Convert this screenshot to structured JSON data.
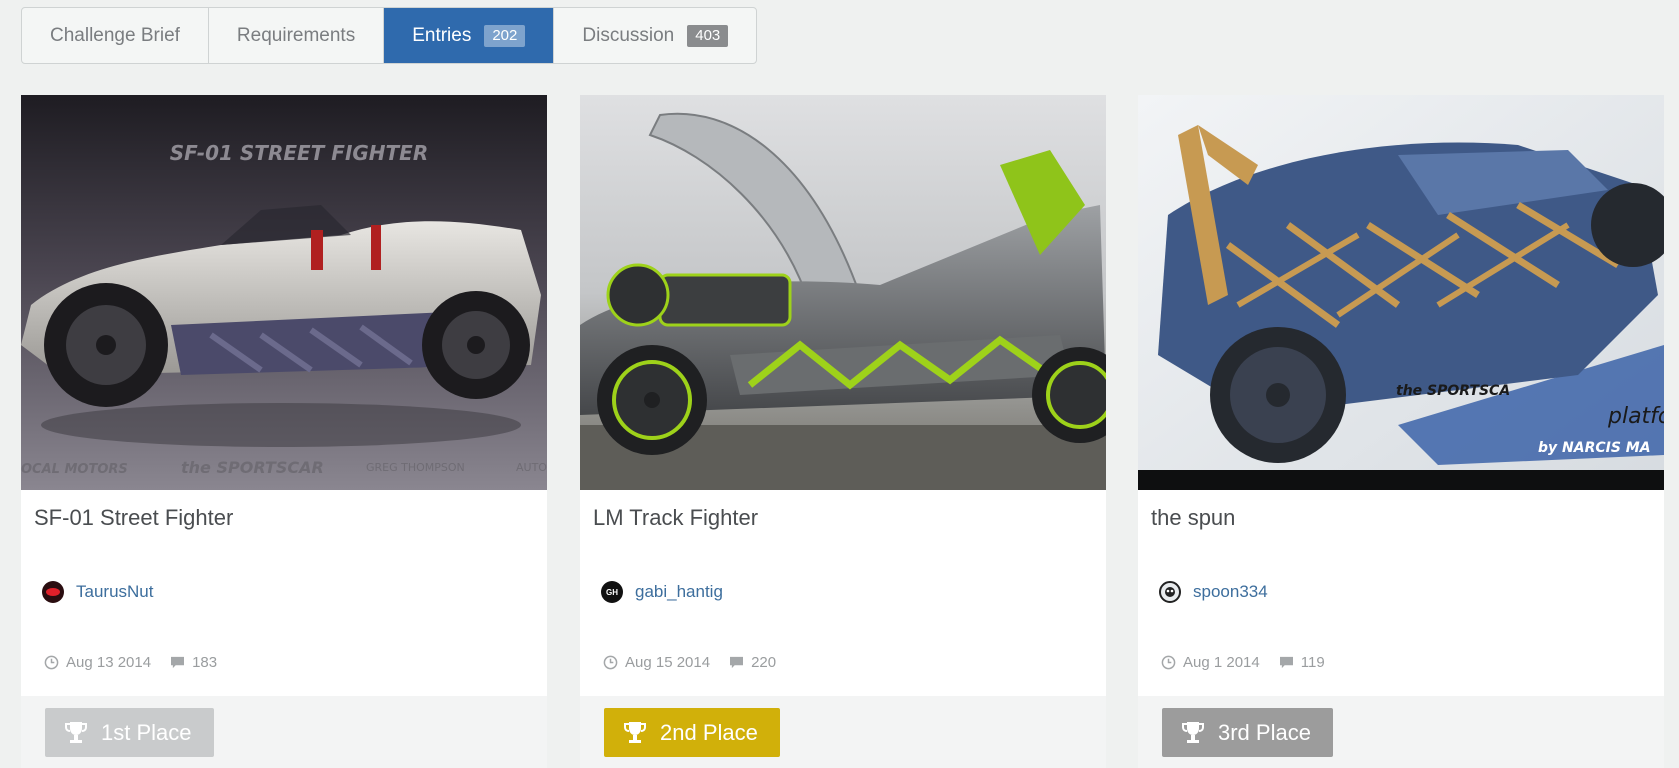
{
  "tabs": [
    {
      "label": "Challenge Brief",
      "count": ""
    },
    {
      "label": "Requirements",
      "count": ""
    },
    {
      "label": "Entries",
      "count": "202"
    },
    {
      "label": "Discussion",
      "count": "403"
    }
  ],
  "active_tab": "Entries",
  "entries": [
    {
      "title": "SF-01 Street Fighter",
      "author": "TaurusNut",
      "date": "Aug 13 2014",
      "comments": "183",
      "place": "1st Place",
      "place_color": "#c9cbcc",
      "image_text": {
        "headline": "SF-01 STREET FIGHTER",
        "brand1": "OCAL MOTORS",
        "brand2": "the SPORTSCAR",
        "brand3": "GREG THOMPSON",
        "brand4": "AUTO"
      }
    },
    {
      "title": "LM Track Fighter",
      "author": "gabi_hantig",
      "date": "Aug 15 2014",
      "comments": "220",
      "place": "2nd Place",
      "place_color": "#d1b00a",
      "image_text": {
        "avatar_initials": "GH"
      }
    },
    {
      "title": "the spun",
      "author": "spoon334",
      "date": "Aug 1 2014",
      "comments": "119",
      "place": "3rd Place",
      "place_color": "#9c9c9c",
      "image_text": {
        "brand1": "the SPORTSCA",
        "brand2": "platfo",
        "brand3": "by NARCIS MA"
      }
    }
  ],
  "colors": {
    "accent": "#2f6aad",
    "link": "#3d6e9d",
    "gold": "#d1b00a",
    "silver": "#9c9c9c",
    "muted": "#c9cbcc"
  },
  "icons": {
    "clock": "clock-icon",
    "comment": "comment-icon",
    "trophy": "trophy-icon"
  }
}
